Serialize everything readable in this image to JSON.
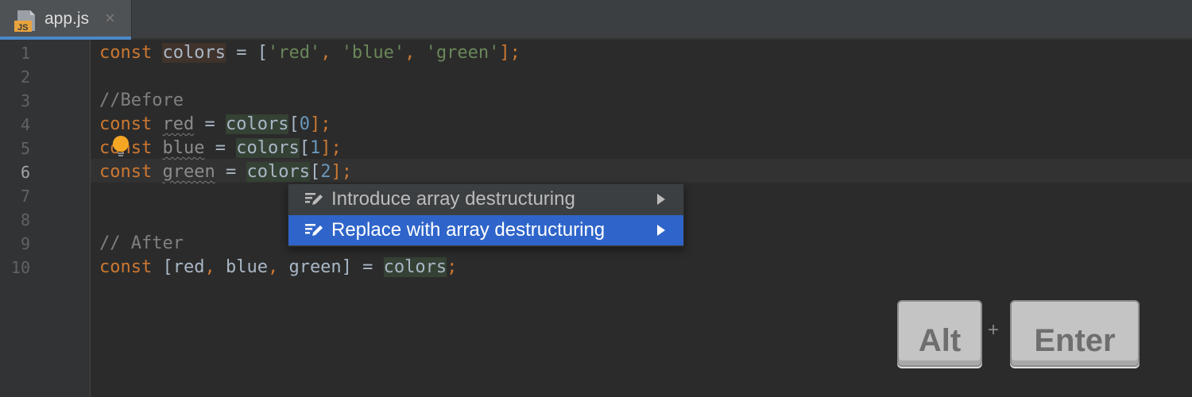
{
  "tab": {
    "icon": "js-file-icon",
    "icon_text": "JS",
    "label": "app.js",
    "close": "×"
  },
  "gutter": {
    "line_numbers": [
      "1",
      "2",
      "3",
      "4",
      "5",
      "6",
      "7",
      "8",
      "9",
      "10"
    ],
    "current_line": "6"
  },
  "code": {
    "l1": {
      "t1": "const",
      "t2": " ",
      "t3": "colors",
      "t4": " = [",
      "t5": "'red'",
      "t6": ", ",
      "t7": "'blue'",
      "t8": ", ",
      "t9": "'green'",
      "t10": "];"
    },
    "l3": {
      "t1": "//Before"
    },
    "l4": {
      "t1": "const",
      "t2": " ",
      "t3": "red",
      "t4": " = ",
      "t5": "colors",
      "t6": "[",
      "t7": "0",
      "t8": "];"
    },
    "l5": {
      "t1": "const",
      "t2": " ",
      "t3": "blue",
      "t4": " = ",
      "t5": "colors",
      "t6": "[",
      "t7": "1",
      "t8": "];"
    },
    "l6": {
      "t1": "const",
      "t2": " ",
      "t3": "green",
      "t4": " = ",
      "t5": "colors",
      "t6": "[",
      "t7": "2",
      "t8": "];"
    },
    "l9": {
      "t1": "// After"
    },
    "l10": {
      "t1": "const",
      "t2": " [red",
      "t3": ",",
      "t4": " blue",
      "t5": ",",
      "t6": " green] = ",
      "t7": "colors",
      "t8": ";"
    }
  },
  "intention_popup": {
    "items": [
      {
        "label": "Introduce array destructuring",
        "icon": "edit-intention-icon",
        "selected": false
      },
      {
        "label": "Replace with array destructuring",
        "icon": "edit-intention-icon",
        "selected": true
      }
    ]
  },
  "shortcut": {
    "key1": "Alt",
    "plus": "+",
    "key2": "Enter"
  },
  "colors": {
    "background": "#2b2b2b",
    "keyword": "#cc7832",
    "string": "#6a8759",
    "number": "#6897bb",
    "comment": "#808080",
    "selection": "#2f65ca",
    "bulb": "#f5a623"
  }
}
